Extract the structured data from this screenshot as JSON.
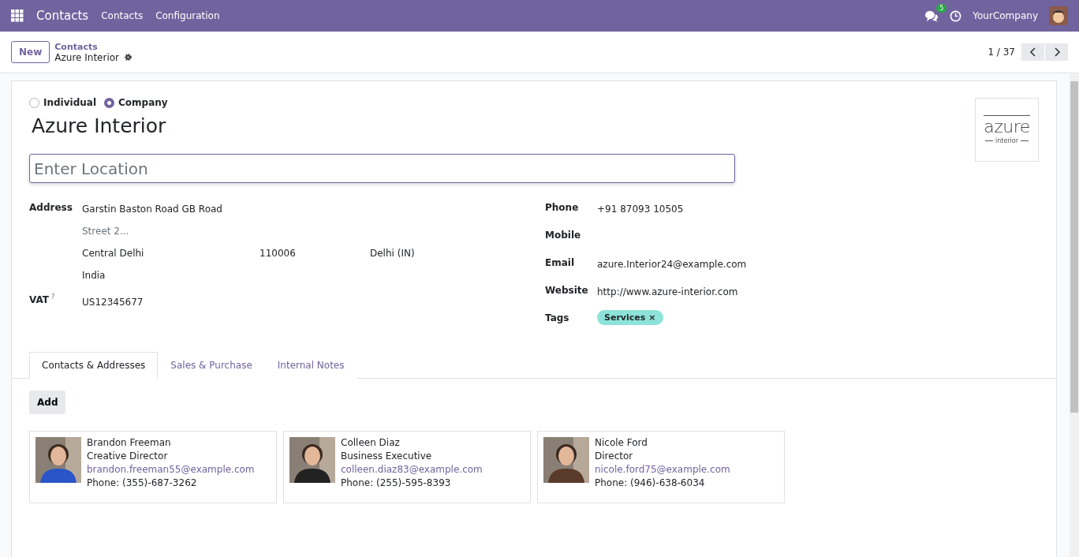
{
  "navbar": {
    "app": "Contacts",
    "menu": [
      "Contacts",
      "Configuration"
    ],
    "message_count": "5",
    "company": "YourCompany"
  },
  "control_bar": {
    "new_button": "New",
    "breadcrumb": "Contacts",
    "record": "Azure Interior",
    "pager": "1 / 37"
  },
  "form": {
    "type_options": [
      {
        "label": "Individual",
        "selected": false
      },
      {
        "label": "Company",
        "selected": true
      }
    ],
    "name": "Azure Interior",
    "location": {
      "placeholder": "Enter Location"
    },
    "logo": {
      "word": "azure",
      "sub": "interior"
    },
    "address": {
      "label": "Address",
      "street": "Garstin Baston Road GB Road",
      "street2": {
        "placeholder": "Street 2..."
      },
      "city": "Central Delhi",
      "zip": "110006",
      "state": "Delhi (IN)",
      "country": "India"
    },
    "vat": {
      "label": "VAT",
      "help": "?",
      "value": "US12345677"
    },
    "right_fields": [
      {
        "label": "Phone",
        "value": "+91 87093 10505"
      },
      {
        "label": "Mobile"
      },
      {
        "label": "Email",
        "value": "azure.Interior24@example.com"
      },
      {
        "label": "Website",
        "value": "http://www.azure-interior.com"
      }
    ],
    "tags": {
      "label": "Tags",
      "items": [
        {
          "label": "Services",
          "remove": "×",
          "color": "#8de3d9"
        }
      ]
    },
    "tabs": [
      {
        "label": "Contacts & Addresses",
        "selected": true
      },
      {
        "label": "Sales & Purchase",
        "selected": false
      },
      {
        "label": "Internal Notes",
        "selected": false
      }
    ],
    "add_button": "Add",
    "contacts": [
      {
        "name": "Brandon Freeman",
        "title": "Creative Director",
        "email": "brandon.freeman55@example.com",
        "phone": "Phone: (355)-687-3262",
        "color": "#2a55c8"
      },
      {
        "name": "Colleen Diaz",
        "title": "Business Executive",
        "email": "colleen.diaz83@example.com",
        "phone": "Phone: (255)-595-8393",
        "color": "#222222"
      },
      {
        "name": "Nicole Ford",
        "title": "Director",
        "email": "nicole.ford75@example.com",
        "phone": "Phone: (946)-638-6034",
        "color": "#5a3a2a"
      }
    ]
  }
}
